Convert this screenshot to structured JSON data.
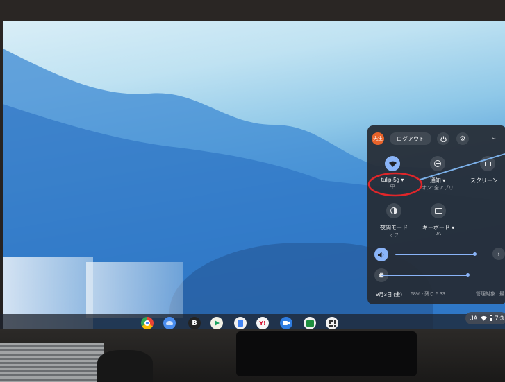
{
  "quick_settings": {
    "avatar_label": "先生",
    "logout_label": "ログアウト",
    "wifi": {
      "name": "tulip-5g",
      "caret": "▾",
      "strength": "中"
    },
    "notifications": {
      "label": "通知",
      "caret": "▾",
      "status": "オン: 全アプリ"
    },
    "screen_capture": {
      "label": "スクリーン..."
    },
    "night_mode": {
      "label": "夜間モード",
      "status": "オフ"
    },
    "keyboard": {
      "label": "キーボード",
      "caret": "▾",
      "status": "JA"
    },
    "volume_level": 0.88,
    "brightness_level": 0.78,
    "date": "9月3日 (金)",
    "battery": "68% - 残り 5:33",
    "managed": "管理対象",
    "managed_more": "最"
  },
  "shelf": {
    "apps": [
      "chrome-icon",
      "files-icon",
      "b-app-icon",
      "play-icon",
      "docs-icon",
      "yahoo-icon",
      "meet-icon",
      "classroom-icon",
      "qr-icon"
    ],
    "b_app_letter": "B",
    "yahoo_letter": "Y!",
    "ime": "JA",
    "clock": "7:3"
  },
  "colors": {
    "accent": "#8ab4f8",
    "avatar": "#e8632a",
    "highlight_circle": "#e0262a",
    "pointer_line": "#7aaee6"
  }
}
